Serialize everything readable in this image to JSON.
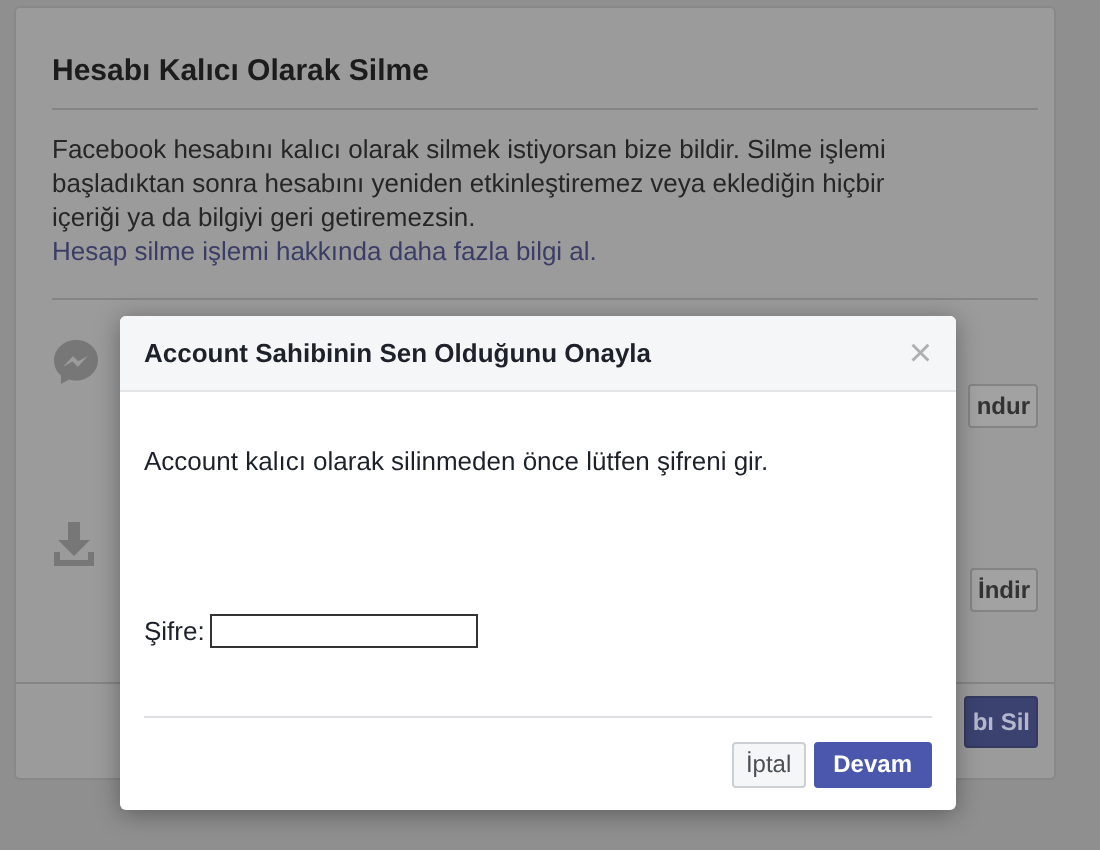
{
  "background_card": {
    "title": "Hesabı Kalıcı Olarak Silme",
    "description": "Facebook hesabını kalıcı olarak silmek istiyorsan bize bildir. Silme işlemi başladıktan sonra hesabını yeniden etkinleştiremez veya eklediğin hiçbir içeriği ya da bilgiyi geri getiremezsin.",
    "link": "Hesap silme işlemi hakkında daha fazla bilgi al.",
    "rows": [
      {
        "kind": "messenger",
        "button": "ndur"
      },
      {
        "kind": "download",
        "button": "İndir"
      }
    ],
    "footer_button": "bı Sil"
  },
  "dialog": {
    "title": "Account Sahibinin Sen Olduğunu Onayla",
    "close": "×",
    "message": "Account kalıcı olarak silinmeden önce lütfen şifreni gir.",
    "password_label": "Şifre:",
    "buttons": [
      {
        "label": "İptal",
        "kind": "secondary"
      },
      {
        "label": "Devam",
        "kind": "primary"
      }
    ]
  }
}
